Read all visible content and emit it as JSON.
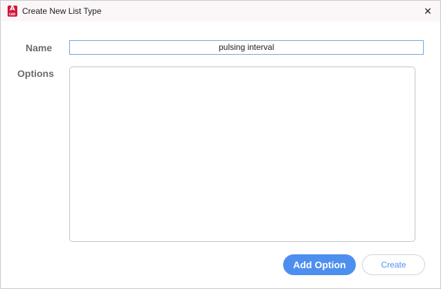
{
  "window": {
    "title": "Create New List Type",
    "app_icon": {
      "letter": "A",
      "caption": "CAD",
      "color": "#d1173a"
    },
    "close_icon": "close-icon"
  },
  "form": {
    "name_label": "Name",
    "name_value": "pulsing interval",
    "options_label": "Options",
    "options_value": ""
  },
  "buttons": {
    "add_option": "Add Option",
    "create": "Create"
  },
  "colors": {
    "accent": "#4d8fee",
    "input_focus_border": "#6fa8de",
    "label_text": "#6b6b6b"
  }
}
